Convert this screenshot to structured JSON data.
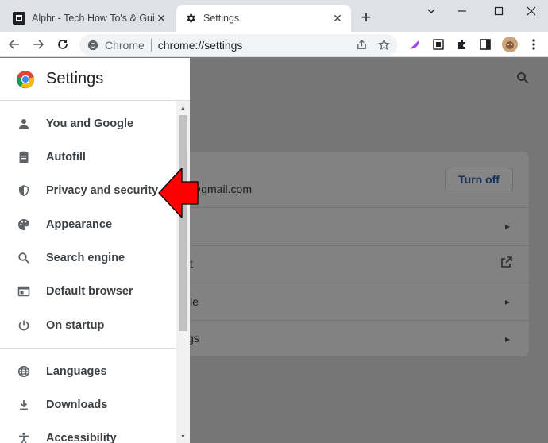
{
  "tabs": [
    {
      "title": "Alphr - Tech How To's & Guides",
      "favicon": "alphr-logo-icon",
      "active": false
    },
    {
      "title": "Settings",
      "favicon": "gear-icon",
      "active": true
    }
  ],
  "omnibox": {
    "chip": "Chrome",
    "url": "chrome://settings"
  },
  "settings": {
    "title": "Settings",
    "nav": [
      {
        "label": "You and Google",
        "icon": "person-icon"
      },
      {
        "label": "Autofill",
        "icon": "clipboard-icon"
      },
      {
        "label": "Privacy and security",
        "icon": "shield-icon"
      },
      {
        "label": "Appearance",
        "icon": "palette-icon"
      },
      {
        "label": "Search engine",
        "icon": "search-icon"
      },
      {
        "label": "Default browser",
        "icon": "browser-window-icon"
      },
      {
        "label": "On startup",
        "icon": "power-icon"
      },
      {
        "label": "Languages",
        "icon": "globe-icon"
      },
      {
        "label": "Downloads",
        "icon": "download-icon"
      },
      {
        "label": "Accessibility",
        "icon": "accessibility-icon"
      }
    ]
  },
  "background": {
    "email_fragment": "@gmail.com",
    "turn_off": "Turn off",
    "row_fragments": [
      "t",
      "ile",
      "gs"
    ]
  },
  "colors": {
    "annotation_arrow": "#ff0000",
    "accent": "#1a73e8"
  }
}
